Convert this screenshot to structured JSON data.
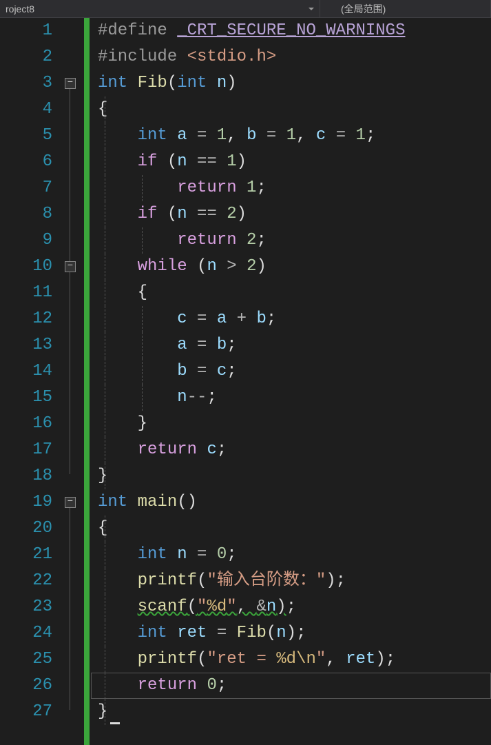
{
  "header": {
    "project_dropdown": "roject8",
    "scope_dropdown": "(全局范围)"
  },
  "lines": {
    "n1": "1",
    "n2": "2",
    "n3": "3",
    "n4": "4",
    "n5": "5",
    "n6": "6",
    "n7": "7",
    "n8": "8",
    "n9": "9",
    "n10": "10",
    "n11": "11",
    "n12": "12",
    "n13": "13",
    "n14": "14",
    "n15": "15",
    "n16": "16",
    "n17": "17",
    "n18": "18",
    "n19": "19",
    "n20": "20",
    "n21": "21",
    "n22": "22",
    "n23": "23",
    "n24": "24",
    "n25": "25",
    "n26": "26",
    "n27": "27"
  },
  "tok": {
    "define": "#define",
    "crt_macro": "_CRT_SECURE_NO_WARNINGS",
    "include": "#include",
    "stdio": "<stdio.h>",
    "int": "int",
    "Fib": "Fib",
    "n": "n",
    "a": "a",
    "b": "b",
    "c": "c",
    "ret_var": "ret",
    "if": "if",
    "return": "return",
    "while": "while",
    "main": "main",
    "printf": "printf",
    "scanf": "scanf",
    "eq": " = ",
    "eqeq": " == ",
    "gt": " > ",
    "plus": " + ",
    "minusminus": "--",
    "amp": "&",
    "comma_sp": ", ",
    "semi": ";",
    "lparen": "(",
    "rparen": ")",
    "lbrace": "{",
    "rbrace": "}",
    "num0": "0",
    "num1": "1",
    "num2": "2",
    "str_prompt": "\"输入台阶数：\"",
    "str_fmt_d_pre": "\"",
    "str_fmt_d_esc": "%d",
    "str_fmt_d_post": "\"",
    "str_ret_pre": "\"ret = ",
    "str_ret_esc1": "%d",
    "str_ret_esc2": "\\n",
    "str_ret_post": "\"",
    "fold_minus": "−"
  }
}
